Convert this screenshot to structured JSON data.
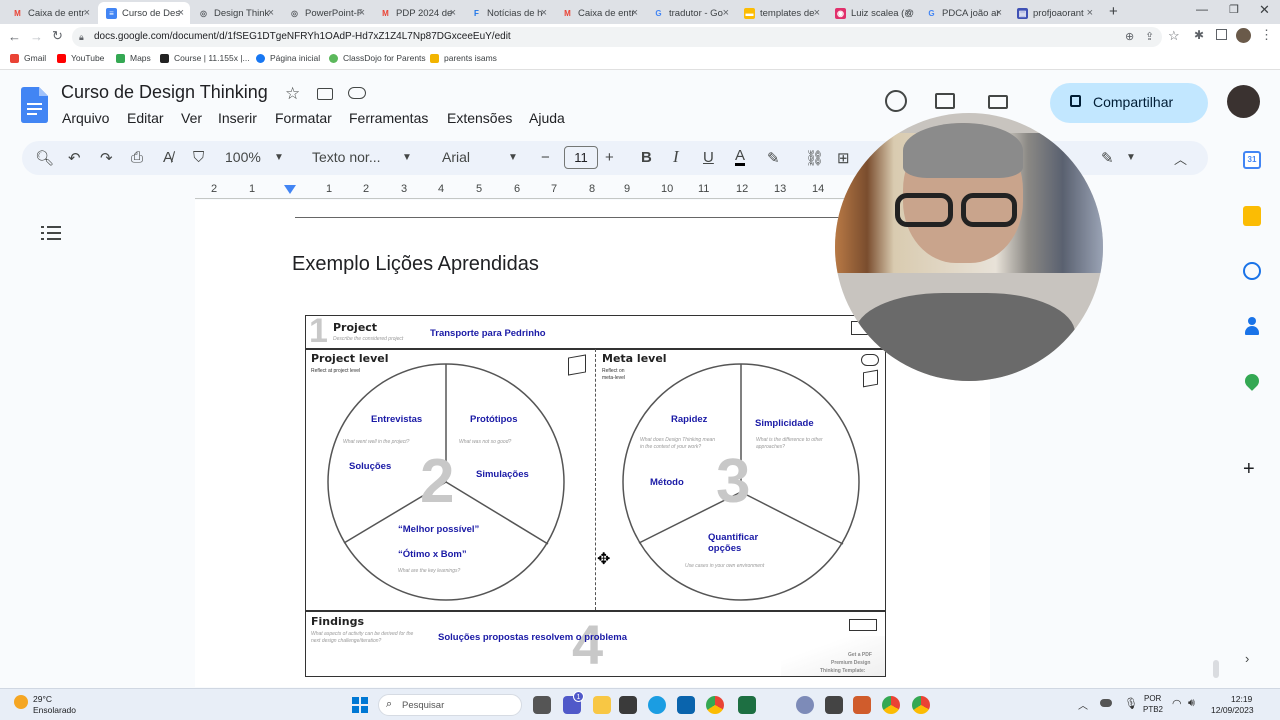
{
  "browser": {
    "tabs": [
      {
        "title": "Caixa de entr",
        "color": "#ea4335",
        "glyph": "M"
      },
      {
        "title": "Curso de Des",
        "color": "#4285f4",
        "glyph": "≡"
      },
      {
        "title": "Design Think",
        "color": "#5f6368",
        "glyph": "◎"
      },
      {
        "title": "PowerPoint-F",
        "color": "#5f6368",
        "glyph": "◎"
      },
      {
        "title": "PDP 2024 de",
        "color": "#ea4335",
        "glyph": "M"
      },
      {
        "title": "Notícias de h",
        "color": "#1a73e8",
        "glyph": "F"
      },
      {
        "title": "Caixa de entr",
        "color": "#ea4335",
        "glyph": "M"
      },
      {
        "title": "tradutor - Go",
        "color": "#5f6368",
        "glyph": "G"
      },
      {
        "title": "templates de",
        "color": "#fbbc04",
        "glyph": "▬"
      },
      {
        "title": "Luiz scalea (@",
        "color": "#e1306c",
        "glyph": "◉"
      },
      {
        "title": "PDCA joão ar",
        "color": "#5f6368",
        "glyph": "G"
      },
      {
        "title": "profjoaorant",
        "color": "#3f51b5",
        "glyph": "▤"
      }
    ],
    "new_tab": "+",
    "url": "docs.google.com/document/d/1fSEG1DTgeNFRYh1OAdP-Hd7xZ1Z4L7Np87DGxceeEuY/edit",
    "bookmarks": [
      {
        "label": "Gmail",
        "color": "#ea4335"
      },
      {
        "label": "YouTube",
        "color": "#ff0000"
      },
      {
        "label": "Maps",
        "color": "#34a853"
      },
      {
        "label": "Course | 11.155x |...",
        "color": "#222222"
      },
      {
        "label": "Página inicial",
        "color": "#1877f2"
      },
      {
        "label": "ClassDojo for Parents",
        "color": "#5cb85c"
      },
      {
        "label": "parents isams",
        "color": "#f2b400"
      }
    ]
  },
  "doc": {
    "title": "Curso de Design Thinking",
    "menus": [
      "Arquivo",
      "Editar",
      "Ver",
      "Inserir",
      "Formatar",
      "Ferramentas",
      "Extensões",
      "Ajuda"
    ],
    "share_label": "Compartilhar",
    "toolbar": {
      "zoom": "100%",
      "style": "Texto nor...",
      "font": "Arial",
      "size": "11",
      "minus": "−",
      "plus": "+",
      "bold": "B",
      "italic": "I",
      "underline": "U",
      "text_color": "A"
    },
    "ruler": [
      "2",
      "1",
      "1",
      "2",
      "3",
      "4",
      "5",
      "6",
      "7",
      "8",
      "9",
      "10",
      "11",
      "12",
      "13",
      "14"
    ],
    "heading": "Exemplo Lições Aprendidas"
  },
  "template": {
    "project": {
      "title": "Project",
      "num": "1",
      "desc": "Describe the considered project",
      "value": "Transporte para Pedrinho"
    },
    "project_level": {
      "title": "Project level",
      "sub": "Reflect at project level",
      "num": "2",
      "q1": "What went well in the project?",
      "q2": "What was not so good?",
      "q3": "What are the key learnings?",
      "entries": [
        "Entrevistas",
        "Protótipos",
        "Soluções",
        "Simulações",
        "“Melhor possível”",
        "“Ótimo x Bom”"
      ]
    },
    "meta_level": {
      "title": "Meta level",
      "sub1": "Reflect on",
      "sub2": "meta-level",
      "num": "3",
      "q1a": "What does Design Thinking mean",
      "q1b": "in the context of your work?",
      "q2a": "What is the difference to other",
      "q2b": "approaches?",
      "q3": "Use cases in your own environment",
      "entries": [
        "Rapidez",
        "Simplicidade",
        "Método",
        "Quantificar",
        "opções"
      ]
    },
    "findings": {
      "title": "Findings",
      "num": "4",
      "desc1": "What aspects of activity can be derived for the",
      "desc2": "next design challenge/iteration?",
      "value": "Soluções propostas resolvem o problema"
    },
    "promo": [
      "Get a PDF",
      "Premium Design",
      "Thinking Template:"
    ]
  },
  "taskbar": {
    "weather_temp": "29°C",
    "weather_desc": "Ensolarado",
    "search_placeholder": "Pesquisar",
    "lang1": "POR",
    "lang2": "PTB2",
    "time": "12:19",
    "date": "12/09/2023",
    "badge": "1"
  },
  "colors": {
    "accent": "#c2e7ff",
    "docs_blue": "#4285f4",
    "template_text": "#1a1aa6"
  }
}
